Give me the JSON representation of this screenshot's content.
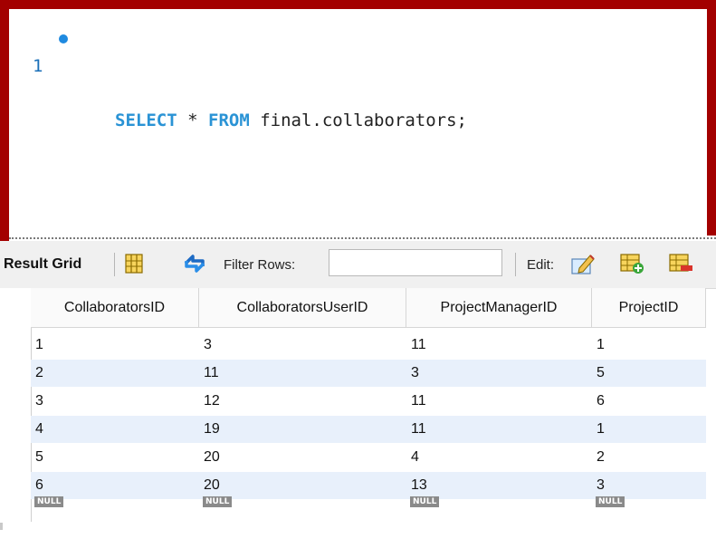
{
  "editor": {
    "line_number": "1",
    "query": {
      "select": "SELECT",
      "star": "*",
      "from": "FROM",
      "target": "final.collaborators;"
    }
  },
  "toolbar": {
    "result_grid_label": "Result Grid",
    "filter_label": "Filter Rows:",
    "filter_value": "",
    "edit_label": "Edit:"
  },
  "grid": {
    "columns": [
      "CollaboratorsID",
      "CollaboratorsUserID",
      "ProjectManagerID",
      "ProjectID"
    ],
    "rows": [
      [
        "1",
        "3",
        "11",
        "1"
      ],
      [
        "2",
        "11",
        "3",
        "5"
      ],
      [
        "3",
        "12",
        "11",
        "6"
      ],
      [
        "4",
        "19",
        "11",
        "1"
      ],
      [
        "5",
        "20",
        "4",
        "2"
      ],
      [
        "6",
        "20",
        "13",
        "3"
      ]
    ],
    "null_label": "NULL"
  },
  "colors": {
    "frame": "#a30000",
    "keyword": "#2a93d5",
    "row_alt": "#e8f0fb"
  },
  "icons": [
    "bullet-icon",
    "grid-layout-icon",
    "refresh-icon",
    "edit-pencil-icon",
    "add-row-icon",
    "delete-row-icon"
  ]
}
